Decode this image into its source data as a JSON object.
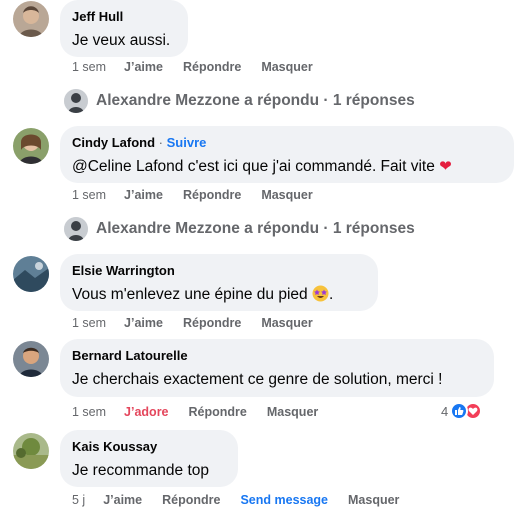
{
  "comments": [
    {
      "author": "Jeff Hull",
      "text": "Je veux aussi.",
      "time": "1 sem",
      "actions": [
        "J’aime",
        "Répondre",
        "Masquer"
      ]
    },
    {
      "author": "Cindy Lafond",
      "follow": "Suivre",
      "follow_dot": "·",
      "text": "@Celine Lafond c'est ici que j'ai commandé. Fait vite",
      "time": "1 sem",
      "actions": [
        "J’aime",
        "Répondre",
        "Masquer"
      ]
    },
    {
      "author": "Elsie Warrington",
      "text": "Vous m'enlevez une épine du pied",
      "text_tail": ".",
      "time": "1 sem",
      "actions": [
        "J’aime",
        "Répondre",
        "Masquer"
      ]
    },
    {
      "author": "Bernard Latourelle",
      "text": "Je cherchais exactement ce genre de solution, merci !",
      "time": "1 sem",
      "actions": [
        "J’adore",
        "Répondre",
        "Masquer"
      ],
      "reaction_count": "4"
    },
    {
      "author": "Kais Koussay",
      "text": "Je recommande top",
      "time": "5 j",
      "actions": [
        "J’aime",
        "Répondre",
        "Send message",
        "Masquer"
      ]
    }
  ],
  "replies": [
    {
      "text": "Alexandre Mezzone a répondu · 1 réponses"
    },
    {
      "text": "Alexandre Mezzone a répondu · 1 réponses"
    }
  ],
  "colors": {
    "link": "#1877f2",
    "adore": "#e4465c",
    "bubble": "#f0f2f5",
    "meta": "#65676b"
  }
}
